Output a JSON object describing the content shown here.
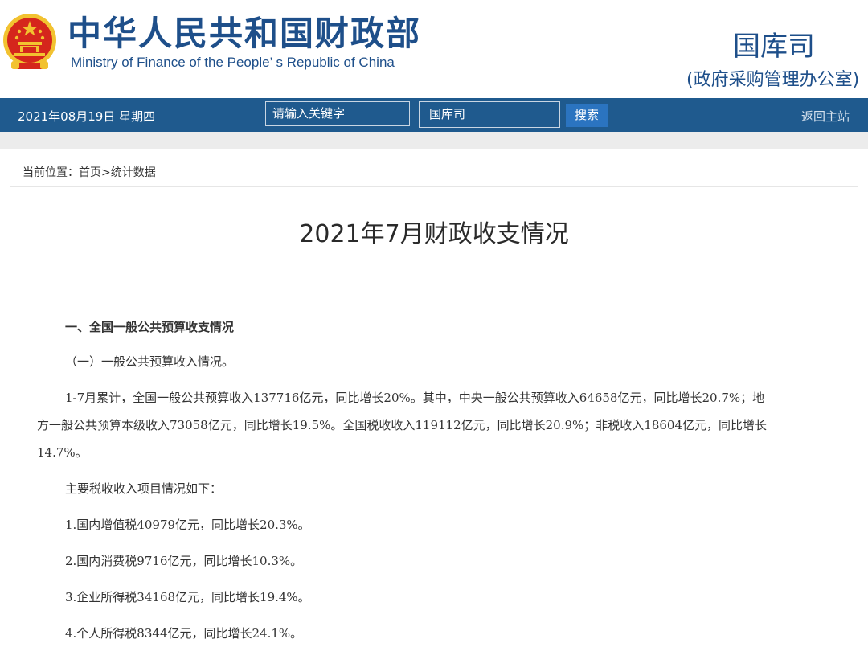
{
  "header": {
    "org_name_cn": "中华人民共和国财政部",
    "org_name_en": "Ministry of Finance of the People’ s Republic of China",
    "department": "国库司",
    "department_sub": "(政府采购管理办公室)",
    "emblem_icon": "national-emblem-icon",
    "colors": {
      "brand_blue": "#1e4f8a",
      "emblem_red": "#d5261c",
      "emblem_gold": "#f2c230"
    }
  },
  "navbar": {
    "date": "2021年08月19日  星期四",
    "search_placeholder": "请输入关键字",
    "scope_value": "国库司",
    "search_button": "搜索",
    "home_link": "返回主站",
    "colors": {
      "bar": "#1f5a8e",
      "button": "#2b74c0"
    }
  },
  "breadcrumb": {
    "prefix": "当前位置：",
    "home": "首页",
    "separator": ">",
    "current": "统计数据"
  },
  "article": {
    "title": "2021年7月财政收支情况",
    "section_heading": "一、全国一般公共预算收支情况",
    "sub_heading": "（一）一般公共预算收入情况。",
    "para_lines": [
      "1-7月累计，全国一般公共预算收入137716亿元，同比增长20%。其中，中央一般公共预算收入64658亿元，同比增长20.7%；地",
      "方一般公共预算本级收入73058亿元，同比增长19.5%。全国税收收入119112亿元，同比增长20.9%；非税收入18604亿元，同比增长",
      "14.7%。"
    ],
    "tax_intro": "主要税收收入项目情况如下：",
    "tax_items": [
      "1.国内增值税40979亿元，同比增长20.3%。",
      "2.国内消费税9716亿元，同比增长10.3%。",
      "3.企业所得税34168亿元，同比增长19.4%。",
      "4.个人所得税8344亿元，同比增长24.1%。"
    ]
  }
}
